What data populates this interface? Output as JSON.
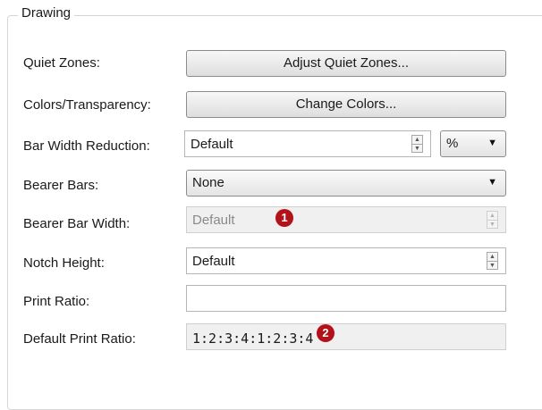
{
  "group": {
    "title": "Drawing"
  },
  "rows": {
    "quiet_zones": {
      "label": "Quiet Zones:",
      "button": "Adjust Quiet Zones..."
    },
    "colors": {
      "label": "Colors/Transparency:",
      "button": "Change Colors..."
    },
    "bar_width_reduction": {
      "label": "Bar Width Reduction:",
      "value": "Default",
      "unit": "%"
    },
    "bearer_bars": {
      "label": "Bearer Bars:",
      "value": "None"
    },
    "bearer_bar_width": {
      "label": "Bearer Bar Width:",
      "value": "Default",
      "disabled": true
    },
    "notch_height": {
      "label": "Notch Height:",
      "value": "Default"
    },
    "print_ratio": {
      "label": "Print Ratio:",
      "value": ""
    },
    "default_print_ratio": {
      "label": "Default Print Ratio:",
      "value": "1:2:3:4:1:2:3:4"
    }
  },
  "callouts": {
    "first": "1",
    "second": "2",
    "color": "#b3121b"
  }
}
